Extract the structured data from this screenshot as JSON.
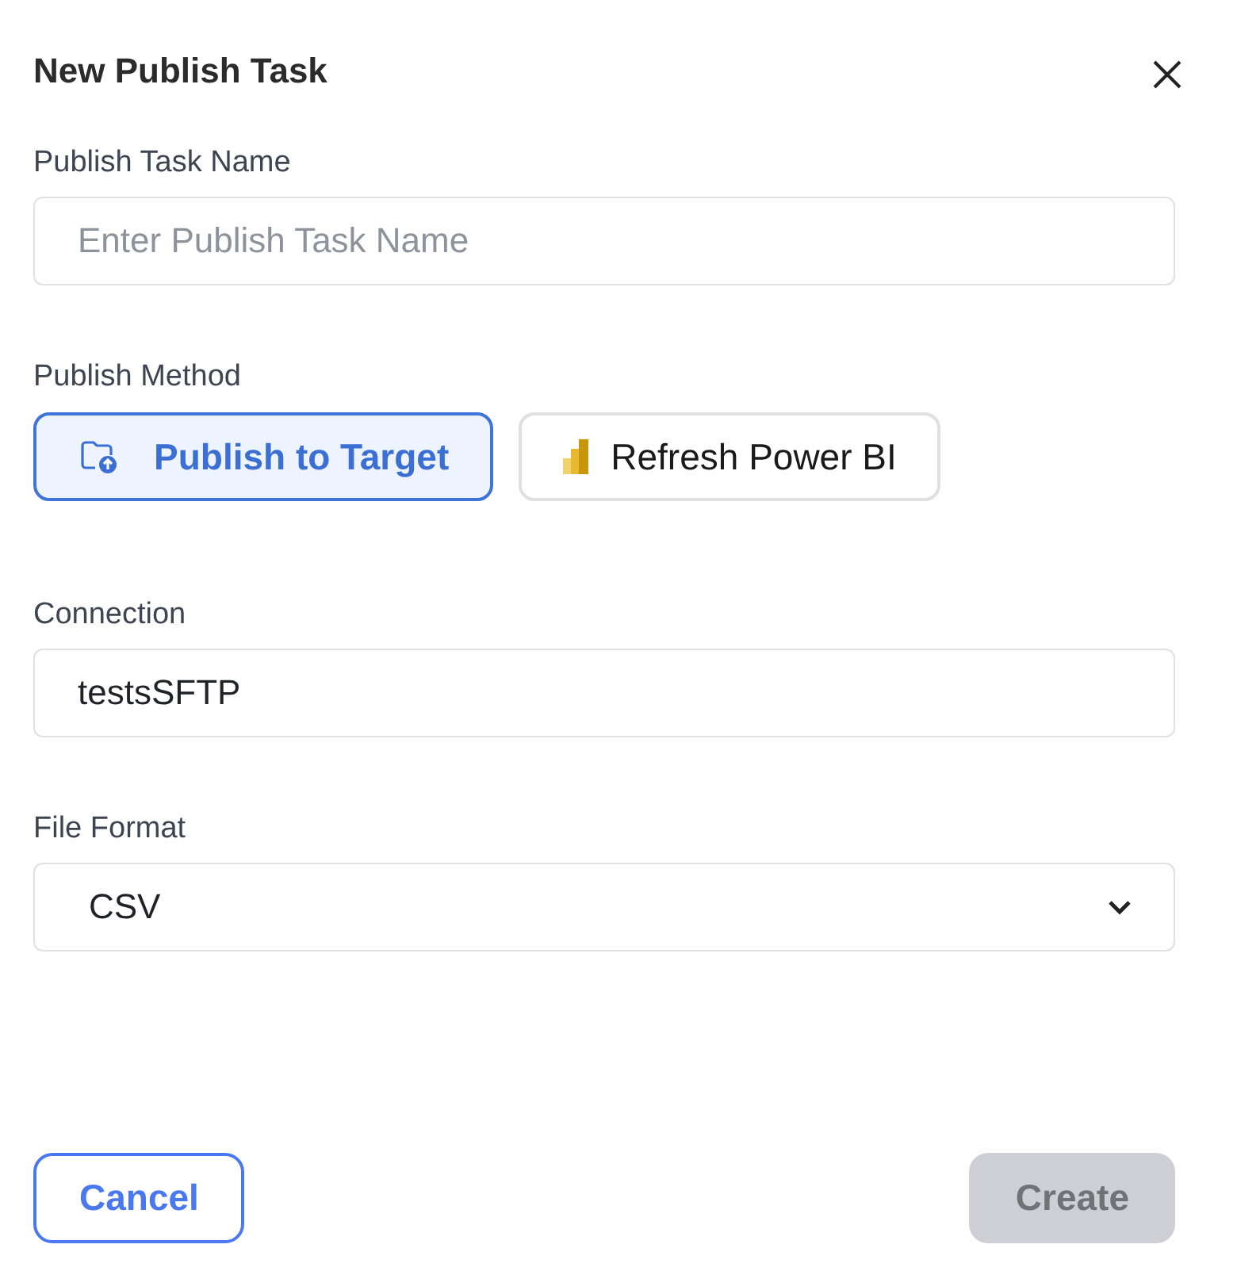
{
  "dialog": {
    "title": "New Publish Task"
  },
  "name_field": {
    "label": "Publish Task Name",
    "placeholder": "Enter Publish Task Name"
  },
  "publish_method": {
    "label": "Publish Method",
    "options": [
      {
        "label": "Publish to Target",
        "kind": "folder",
        "selected": true
      },
      {
        "label": "Refresh Power BI",
        "kind": "powerbi",
        "selected": false
      }
    ]
  },
  "connection": {
    "label": "Connection",
    "value": "testsSFTP"
  },
  "file_format": {
    "label": "File Format",
    "value": "CSV"
  },
  "buttons": [
    {
      "label": "Cancel",
      "kind": "secondary",
      "disabled": false
    },
    {
      "label": "Create",
      "kind": "primary",
      "disabled": true
    }
  ]
}
